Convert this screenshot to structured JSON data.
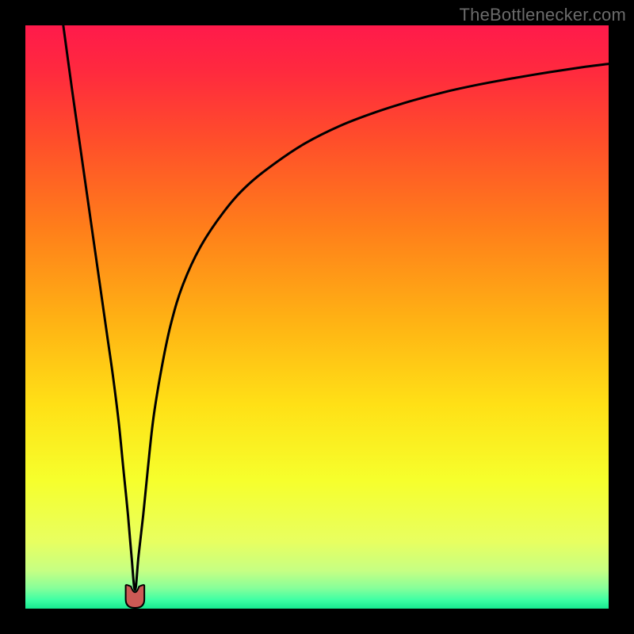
{
  "watermark": "TheBottlenecker.com",
  "colors": {
    "frame": "#000000",
    "watermark": "#6b6b6b",
    "gradient_stops": [
      {
        "offset": 0.0,
        "color": "#ff1a4b"
      },
      {
        "offset": 0.08,
        "color": "#ff2a3e"
      },
      {
        "offset": 0.2,
        "color": "#ff4f2a"
      },
      {
        "offset": 0.35,
        "color": "#ff7f1a"
      },
      {
        "offset": 0.5,
        "color": "#ffb014"
      },
      {
        "offset": 0.65,
        "color": "#ffe016"
      },
      {
        "offset": 0.78,
        "color": "#f6ff2c"
      },
      {
        "offset": 0.885,
        "color": "#e8ff60"
      },
      {
        "offset": 0.935,
        "color": "#c6ff83"
      },
      {
        "offset": 0.965,
        "color": "#86ff9a"
      },
      {
        "offset": 0.985,
        "color": "#3effa4"
      },
      {
        "offset": 1.0,
        "color": "#17e98f"
      }
    ],
    "curve": "#000000",
    "marker_fill": "#cc5a55",
    "marker_outline": "#000000"
  },
  "chart_data": {
    "type": "line",
    "title": "",
    "xlabel": "",
    "ylabel": "",
    "xlim": [
      0,
      100
    ],
    "ylim": [
      0,
      100
    ],
    "grid": false,
    "legend": false,
    "marker": {
      "x": 18.8,
      "width": 3.2,
      "height": 3.8
    },
    "series": [
      {
        "name": "bottleneck-curve",
        "x": [
          6.5,
          8,
          9,
          10,
          11,
          12,
          13,
          14,
          15,
          16,
          16.8,
          17.6,
          18.2,
          18.8,
          19.4,
          20.2,
          21,
          22,
          23.5,
          25,
          27,
          30,
          34,
          38,
          43,
          48,
          54,
          60,
          66,
          72,
          78,
          84,
          90,
          96,
          100
        ],
        "y": [
          100,
          89,
          82,
          75,
          68,
          61,
          54,
          47,
          40,
          32,
          24,
          16,
          9,
          3.2,
          9,
          16,
          24,
          33,
          42,
          49,
          55.5,
          62,
          68,
          72.5,
          76.5,
          79.8,
          82.8,
          85.1,
          87,
          88.6,
          89.9,
          91,
          92,
          92.9,
          93.4
        ]
      }
    ],
    "annotations": []
  }
}
